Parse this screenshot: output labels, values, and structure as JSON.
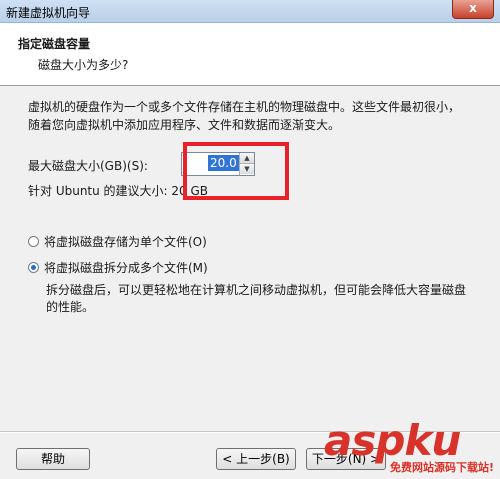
{
  "window": {
    "title": "新建虚拟机向导",
    "close_label": "x"
  },
  "header": {
    "title": "指定磁盘容量",
    "subtitle": "磁盘大小为多少?"
  },
  "description": "虚拟机的硬盘作为一个或多个文件存储在主机的物理磁盘中。这些文件最初很小，随着您向虚拟机中添加应用程序、文件和数据而逐渐变大。",
  "disk_size": {
    "label": "最大磁盘大小(GB)(S):",
    "value": "20.0",
    "recommend": "针对 Ubuntu 的建议大小: 20 GB"
  },
  "options": [
    {
      "label": "将虚拟磁盘存储为单个文件(O)",
      "selected": false
    },
    {
      "label": "将虚拟磁盘拆分成多个文件(M)",
      "selected": true
    }
  ],
  "split_note": "拆分磁盘后，可以更轻松地在计算机之间移动虚拟机，但可能会降低大容量磁盘的性能。",
  "buttons": {
    "help": "帮助",
    "back": "< 上一步(B)",
    "next": "下一步(N) >"
  },
  "watermark": {
    "logo": "aspku",
    "tagline": "免费网站源码下载站!"
  },
  "colors": {
    "highlight": "#e8212a",
    "selection": "#3075d6"
  }
}
